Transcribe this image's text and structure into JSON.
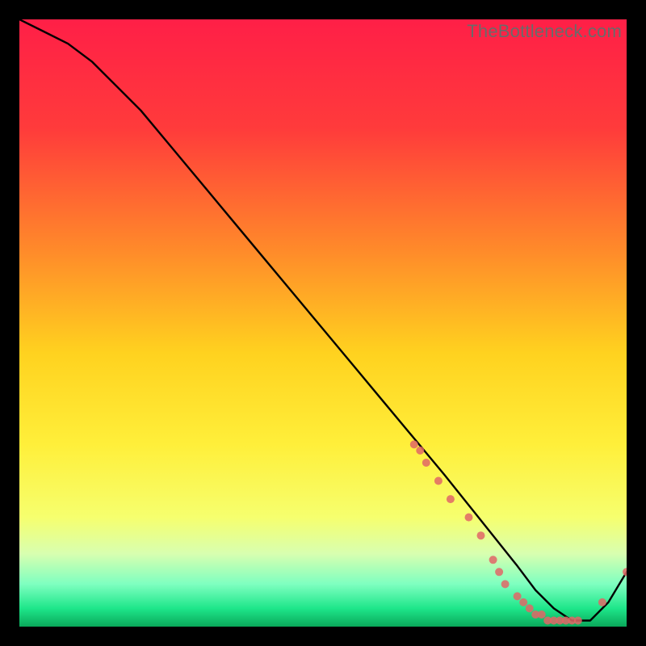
{
  "watermark": "TheBottleneck.com",
  "chart_data": {
    "type": "line",
    "title": "",
    "xlabel": "",
    "ylabel": "",
    "xlim": [
      0,
      100
    ],
    "ylim": [
      0,
      100
    ],
    "gradient_stops": [
      {
        "offset": 0,
        "color": "#ff1f47"
      },
      {
        "offset": 0.18,
        "color": "#ff3b3b"
      },
      {
        "offset": 0.38,
        "color": "#ff8a2a"
      },
      {
        "offset": 0.55,
        "color": "#ffd21f"
      },
      {
        "offset": 0.7,
        "color": "#ffef3a"
      },
      {
        "offset": 0.82,
        "color": "#f6ff6e"
      },
      {
        "offset": 0.88,
        "color": "#d8ffb0"
      },
      {
        "offset": 0.93,
        "color": "#7effc0"
      },
      {
        "offset": 0.97,
        "color": "#1ee68a"
      },
      {
        "offset": 1.0,
        "color": "#0aa85a"
      }
    ],
    "series": [
      {
        "name": "bottleneck-curve",
        "color": "#000000",
        "x": [
          0,
          4,
          8,
          12,
          16,
          20,
          25,
          30,
          35,
          40,
          45,
          50,
          55,
          60,
          65,
          70,
          74,
          78,
          82,
          85,
          88,
          91,
          94,
          97,
          100
        ],
        "y": [
          100,
          98,
          96,
          93,
          89,
          85,
          79,
          73,
          67,
          61,
          55,
          49,
          43,
          37,
          31,
          25,
          20,
          15,
          10,
          6,
          3,
          1,
          1,
          4,
          9
        ]
      }
    ],
    "scatter": {
      "name": "data-points",
      "color": "#e06666",
      "radius": 5,
      "x": [
        65,
        66,
        67,
        69,
        71,
        74,
        76,
        78,
        79,
        80,
        82,
        83,
        84,
        85,
        86,
        87,
        88,
        89,
        90,
        91,
        92,
        96,
        100
      ],
      "y": [
        30,
        29,
        27,
        24,
        21,
        18,
        15,
        11,
        9,
        7,
        5,
        4,
        3,
        2,
        2,
        1,
        1,
        1,
        1,
        1,
        1,
        4,
        9
      ]
    }
  }
}
